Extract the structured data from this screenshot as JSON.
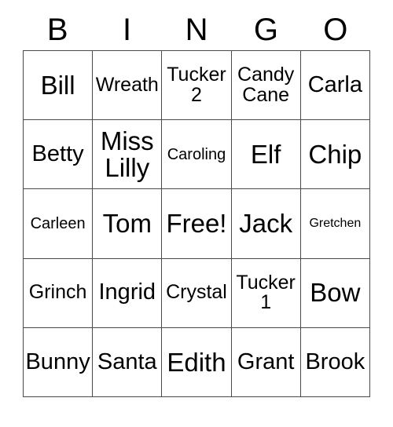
{
  "card": {
    "header": {
      "letters": [
        "B",
        "I",
        "N",
        "G",
        "O"
      ]
    },
    "rows": [
      [
        {
          "text": "Bill",
          "size": "fs-xl"
        },
        {
          "text": "Wreath",
          "size": "fs-md"
        },
        {
          "text": "Tucker 2",
          "size": "fs-md"
        },
        {
          "text": "Candy Cane",
          "size": "fs-md"
        },
        {
          "text": "Carla",
          "size": "fs-lg"
        }
      ],
      [
        {
          "text": "Betty",
          "size": "fs-lg"
        },
        {
          "text": "Miss Lilly",
          "size": "fs-xl"
        },
        {
          "text": "Caroling",
          "size": "fs-sm"
        },
        {
          "text": "Elf",
          "size": "fs-xl"
        },
        {
          "text": "Chip",
          "size": "fs-xl"
        }
      ],
      [
        {
          "text": "Carleen",
          "size": "fs-sm"
        },
        {
          "text": "Tom",
          "size": "fs-xl"
        },
        {
          "text": "Free!",
          "size": "fs-xl"
        },
        {
          "text": "Jack",
          "size": "fs-xl"
        },
        {
          "text": "Gretchen",
          "size": "fs-xs"
        }
      ],
      [
        {
          "text": "Grinch",
          "size": "fs-md"
        },
        {
          "text": "Ingrid",
          "size": "fs-lg"
        },
        {
          "text": "Crystal",
          "size": "fs-md"
        },
        {
          "text": "Tucker 1",
          "size": "fs-md"
        },
        {
          "text": "Bow",
          "size": "fs-xl"
        }
      ],
      [
        {
          "text": "Bunny",
          "size": "fs-lg"
        },
        {
          "text": "Santa",
          "size": "fs-lg"
        },
        {
          "text": "Edith",
          "size": "fs-xl"
        },
        {
          "text": "Grant",
          "size": "fs-lg"
        },
        {
          "text": "Brook",
          "size": "fs-lg"
        }
      ]
    ]
  }
}
